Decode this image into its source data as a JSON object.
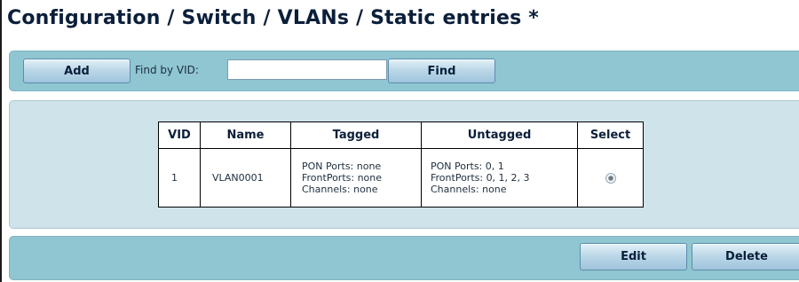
{
  "page": {
    "title": "Configuration / Switch / VLANs / Static entries *"
  },
  "toolbar": {
    "add_label": "Add",
    "find_label": "Find by VID:",
    "find_value": "",
    "find_button_label": "Find"
  },
  "table": {
    "headers": {
      "vid": "VID",
      "name": "Name",
      "tagged": "Tagged",
      "untagged": "Untagged",
      "select": "Select"
    },
    "rows": [
      {
        "vid": "1",
        "name": "VLAN0001",
        "tagged": [
          "PON Ports: none",
          "FrontPorts: none",
          "Channels: none"
        ],
        "untagged": [
          "PON Ports: 0, 1",
          "FrontPorts: 0, 1, 2, 3",
          "Channels: none"
        ],
        "selected": true
      }
    ]
  },
  "actions": {
    "edit_label": "Edit",
    "delete_label": "Delete"
  },
  "colors": {
    "panel_dark": "#8fc6d1",
    "panel_light": "#cfe3ea",
    "title_text": "#0b1f3a"
  }
}
